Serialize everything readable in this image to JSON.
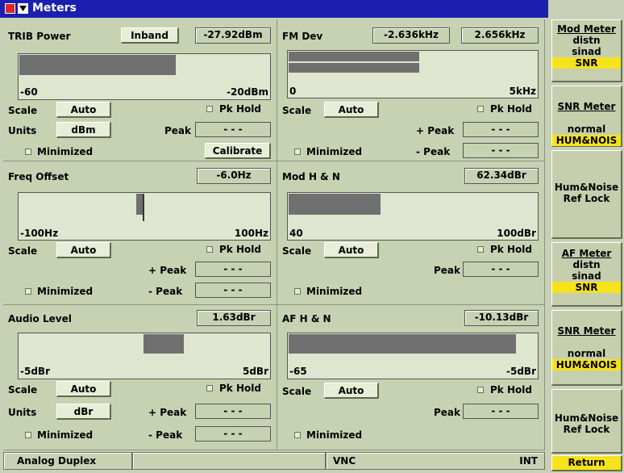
{
  "window": {
    "title": "Meters"
  },
  "panels": {
    "trib": {
      "title": "TRIB Power",
      "mode": "Inband",
      "value": "-27.92dBm",
      "bar_fraction": 0.625,
      "scale_min": "-60",
      "scale_max": "-20dBm",
      "scale_label": "Scale",
      "scale_value": "Auto",
      "pk_hold": "Pk Hold",
      "units_label": "Units",
      "units_value": "dBm",
      "peak_label": "Peak",
      "peak_value": "- - -",
      "minimized": "Minimized",
      "calibrate": "Calibrate"
    },
    "fmdev": {
      "title": "FM Dev",
      "value1": "-2.636kHz",
      "value2": "2.656kHz",
      "bar_fraction": 0.527,
      "scale_min": "0",
      "scale_max": "5kHz",
      "scale_label": "Scale",
      "scale_value": "Auto",
      "pk_hold": "Pk Hold",
      "plus_peak_label": "+ Peak",
      "plus_peak_value": "- - -",
      "minus_peak_label": "- Peak",
      "minus_peak_value": "- - -",
      "minimized": "Minimized"
    },
    "freq": {
      "title": "Freq Offset",
      "value": "-6.0Hz",
      "marker_fraction": 0.47,
      "scale_min": "-100Hz",
      "scale_max": "100Hz",
      "scale_label": "Scale",
      "scale_value": "Auto",
      "pk_hold": "Pk Hold",
      "plus_peak_label": "+ Peak",
      "plus_peak_value": "- - -",
      "minus_peak_label": "- Peak",
      "minus_peak_value": "- - -",
      "minimized": "Minimized"
    },
    "modhn": {
      "title": "Mod H & N",
      "value": "62.34dBr",
      "bar_fraction": 0.37,
      "scale_min": "40",
      "scale_max": "100dBr",
      "scale_label": "Scale",
      "scale_value": "Auto",
      "pk_hold": "Pk Hold",
      "peak_label": "Peak",
      "peak_value": "- - -",
      "minimized": "Minimized"
    },
    "audio": {
      "title": "Audio Level",
      "value": "1.63dBr",
      "bar_start_fraction": 0.5,
      "bar_end_fraction": 0.66,
      "scale_min": "-5dBr",
      "scale_max": "5dBr",
      "scale_label": "Scale",
      "scale_value": "Auto",
      "pk_hold": "Pk Hold",
      "units_label": "Units",
      "units_value": "dBr",
      "plus_peak_label": "+ Peak",
      "plus_peak_value": "- - -",
      "minus_peak_label": "- Peak",
      "minus_peak_value": "- - -",
      "minimized": "Minimized"
    },
    "afhn": {
      "title": "AF H & N",
      "value": "-10.13dBr",
      "bar_fraction": 0.915,
      "scale_min": "-65",
      "scale_max": "-5dBr",
      "scale_label": "Scale",
      "scale_value": "Auto",
      "pk_hold": "Pk Hold",
      "peak_label": "Peak",
      "peak_value": "- - -",
      "minimized": "Minimized"
    }
  },
  "softkeys": {
    "k1": {
      "title": "Mod Meter",
      "line1": "distn",
      "line2": "sinad",
      "sel": "SNR"
    },
    "k2": {
      "title": "SNR Meter",
      "line1": "normal",
      "sel": "HUM&NOIS"
    },
    "k3": {
      "line1": "Hum&Noise",
      "line2": "Ref Lock"
    },
    "k4": {
      "title": "AF Meter",
      "line1": "distn",
      "line2": "sinad",
      "sel": "SNR"
    },
    "k5": {
      "title": "SNR Meter",
      "line1": "normal",
      "sel": "HUM&NOIS"
    },
    "k6": {
      "line1": "Hum&Noise",
      "line2": "Ref Lock"
    },
    "ret": "Return"
  },
  "status": {
    "mode": "Analog Duplex",
    "remote": "VNC",
    "ref": "INT"
  },
  "colors": {
    "title_bar": "#1a1fb0",
    "panel_bg": "#c7d2b3",
    "bar_fill": "#707070",
    "highlight": "#f6e21d"
  }
}
